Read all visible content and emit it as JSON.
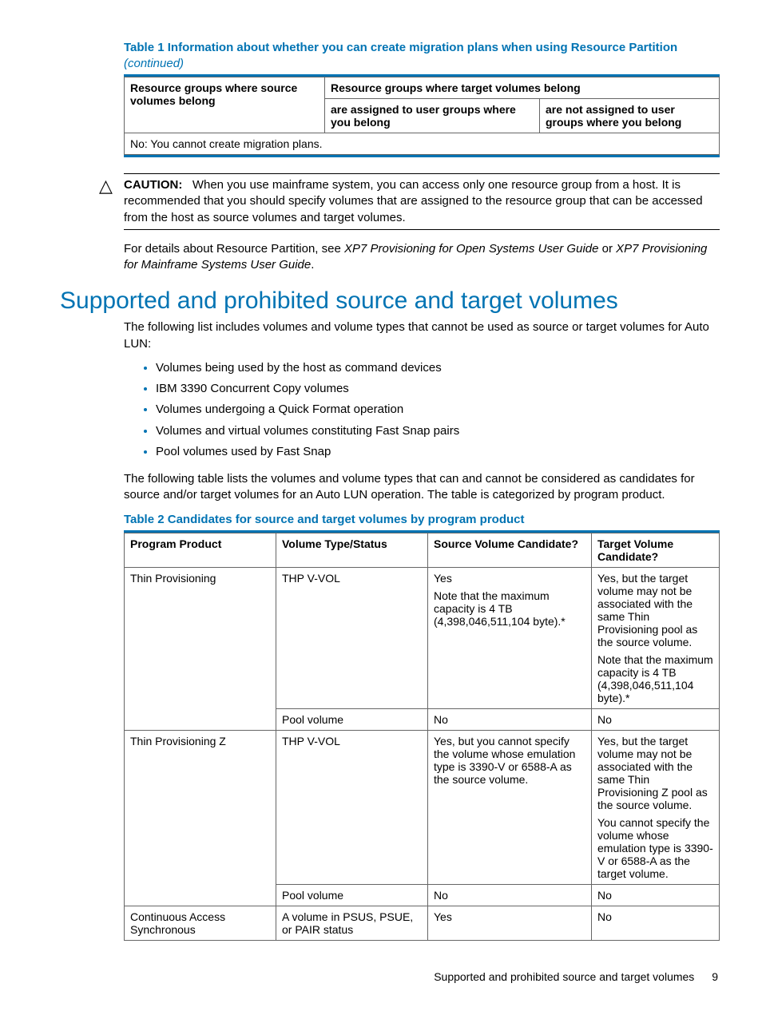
{
  "table1": {
    "title_prefix": "Table 1 Information about whether you can create migration plans when using Resource Partition",
    "continued": "(continued)",
    "h_source": "Resource groups where source volumes belong",
    "h_target": "Resource groups where target volumes belong",
    "h_assigned": "are assigned to user groups where you belong",
    "h_notassigned": "are not assigned to user groups where you belong",
    "note": "No: You cannot create migration plans."
  },
  "caution": {
    "label": "CAUTION:",
    "text": "When you use mainframe system, you can access only one resource group from a host. It is recommended that you should specify volumes that are assigned to the resource group that can be accessed from the host as source volumes and target volumes."
  },
  "detail_para": {
    "p1": "For details about Resource Partition, see ",
    "i1": "XP7 Provisioning for Open Systems User Guide",
    "p2": " or ",
    "i2": "XP7 Provisioning for Mainframe Systems User Guide",
    "p3": "."
  },
  "heading": "Supported and prohibited source and target volumes",
  "intro": "The following list includes volumes and volume types that cannot be used as source or target volumes for Auto LUN:",
  "bullets": [
    "Volumes being used by the host as command devices",
    "IBM 3390 Concurrent Copy volumes",
    "Volumes undergoing a Quick Format operation",
    "Volumes and virtual volumes constituting Fast Snap pairs",
    "Pool volumes used by Fast Snap"
  ],
  "para_after_list": "The following table lists the volumes and volume types that can and cannot be considered as candidates for source and/or target volumes for an Auto LUN operation. The table is categorized by program product.",
  "table2": {
    "title": "Table 2 Candidates for source and target volumes by program product",
    "headers": {
      "c1": "Program Product",
      "c2": "Volume Type/Status",
      "c3": "Source Volume Candidate?",
      "c4": "Target Volume Candidate?"
    },
    "rows": {
      "r1": {
        "c1": "Thin Provisioning",
        "c2": "THP V-VOL",
        "c3a": "Yes",
        "c3b": "Note that the maximum capacity is 4 TB (4,398,046,511,104 byte).*",
        "c4a": "Yes, but the target volume may not be associated with the same Thin Provisioning pool as the source volume.",
        "c4b": "Note that the maximum capacity is 4 TB (4,398,046,511,104 byte).*"
      },
      "r2": {
        "c2": "Pool volume",
        "c3": "No",
        "c4": "No"
      },
      "r3": {
        "c1": "Thin Provisioning Z",
        "c2": "THP V-VOL",
        "c3": "Yes, but you cannot specify the volume whose emulation type is 3390-V or 6588-A as the source volume.",
        "c4a": "Yes, but the target volume may not be associated with the same Thin Provisioning Z pool as the source volume.",
        "c4b": "You cannot specify the volume whose emulation type is 3390-V or 6588-A as the target volume."
      },
      "r4": {
        "c2": "Pool volume",
        "c3": "No",
        "c4": "No"
      },
      "r5": {
        "c1": "Continuous Access Synchronous",
        "c2": "A volume in PSUS, PSUE, or PAIR status",
        "c3": "Yes",
        "c4": "No"
      }
    }
  },
  "footer": {
    "text": "Supported and prohibited source and target volumes",
    "page": "9"
  }
}
